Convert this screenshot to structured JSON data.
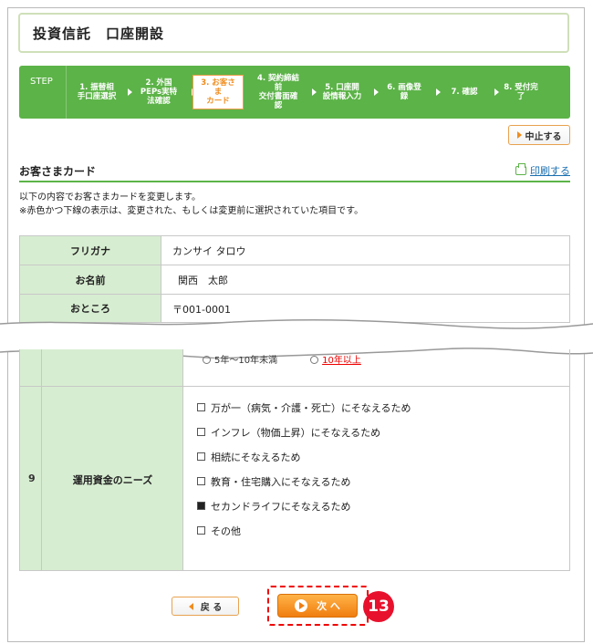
{
  "header": {
    "title": "投資信託　口座開設"
  },
  "steps": {
    "label": "STEP",
    "items": [
      {
        "text": "1. 振替相\n手口座選択"
      },
      {
        "text": "2. 外国\nPEPs実特\n法確認"
      },
      {
        "text": "3. お客さ\nま\nカード"
      },
      {
        "text": "4. 契約締結\n前\n交付書面確\n認"
      },
      {
        "text": "5. 口座開\n設情報入力"
      },
      {
        "text": "6. 画像登\n録"
      },
      {
        "text": "7. 確認"
      },
      {
        "text": "8. 受付完\n了"
      }
    ]
  },
  "actions": {
    "stop": "中止する",
    "print": "印刷する",
    "back": "戻 る",
    "next": "次 へ"
  },
  "section": {
    "title": "お客さまカード",
    "desc1": "以下の内容でお客さまカードを変更します。",
    "desc2": "※赤色かつ下線の表示は、変更された、もしくは変更前に選択されていた項目です。"
  },
  "table": {
    "rows": [
      {
        "label": "フリガナ",
        "value": "カンサイ タロウ"
      },
      {
        "label": "お名前",
        "value": "関西　太郎"
      },
      {
        "label": "おところ",
        "value": "〒001-0001"
      }
    ]
  },
  "lower": {
    "radio1": "5年～10年未満",
    "radio2": "10年以上",
    "num": "9",
    "needs_label": "運用資金のニーズ",
    "checks": [
      {
        "label": "万が一（病気・介護・死亡）にそなえるため",
        "checked": false
      },
      {
        "label": "インフレ（物価上昇）にそなえるため",
        "checked": false
      },
      {
        "label": "相続にそなえるため",
        "checked": false
      },
      {
        "label": "教育・住宅購入にそなえるため",
        "checked": false
      },
      {
        "label": "セカンドライフにそなえるため",
        "checked": true
      },
      {
        "label": "その他",
        "checked": false
      }
    ]
  },
  "badge": "13"
}
